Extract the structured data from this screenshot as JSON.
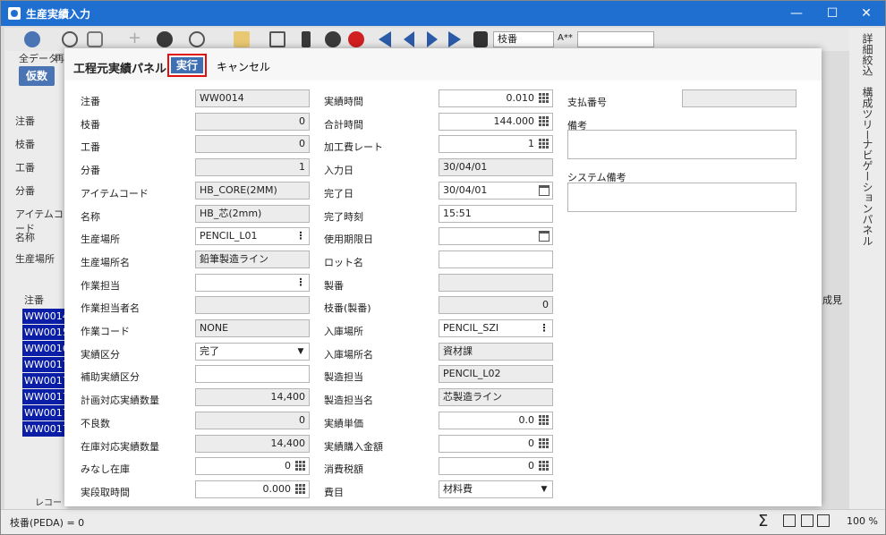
{
  "window": {
    "title": "生産実績入力",
    "minimize": "—",
    "maximize": "☐",
    "close": "✕"
  },
  "background": {
    "toolbar": {
      "sort_value": "枝番",
      "font_size_label": "A**"
    },
    "left_tabs": [
      "全データ",
      "再"
    ],
    "kari_button": "仮数",
    "left_labels": [
      "注番",
      "枝番",
      "工番",
      "分番",
      "アイテムコード",
      "名称",
      "生産場所"
    ],
    "grid_header": "注番",
    "grid_rows": [
      "WW0014",
      "WW0015",
      "WW0016",
      "WW0017",
      "WW0017",
      "WW0017",
      "WW0017",
      "WW0017"
    ],
    "pager_label": "レコー",
    "right_tabs": [
      "詳細絞込",
      "構成ツリー",
      "ナビゲーションパネル"
    ],
    "right_header_partial": "成見",
    "status_left": "枝番(PEDA) = 0",
    "status_zoom": "100  %"
  },
  "panel": {
    "title": "工程元実績パネル",
    "exec_label": "実行",
    "cancel_label": "キャンセル",
    "col1": [
      {
        "label": "注番",
        "value": "WW0014",
        "ro": true,
        "num": false,
        "icon": ""
      },
      {
        "label": "枝番",
        "value": "0",
        "ro": true,
        "num": true,
        "icon": ""
      },
      {
        "label": "工番",
        "value": "0",
        "ro": true,
        "num": true,
        "icon": ""
      },
      {
        "label": "分番",
        "value": "1",
        "ro": true,
        "num": true,
        "icon": ""
      },
      {
        "label": "アイテムコード",
        "value": "HB_CORE(2MM)",
        "ro": true,
        "num": false,
        "icon": ""
      },
      {
        "label": "名称",
        "value": "HB_芯(2mm)",
        "ro": true,
        "num": false,
        "icon": ""
      },
      {
        "label": "生産場所",
        "value": "PENCIL_L01",
        "ro": false,
        "num": false,
        "icon": "dots"
      },
      {
        "label": "生産場所名",
        "value": "鉛筆製造ライン",
        "ro": true,
        "num": false,
        "icon": ""
      },
      {
        "label": "作業担当",
        "value": "",
        "ro": false,
        "num": false,
        "icon": "dots"
      },
      {
        "label": "作業担当者名",
        "value": "",
        "ro": true,
        "num": false,
        "icon": ""
      },
      {
        "label": "作業コード",
        "value": "NONE",
        "ro": true,
        "num": false,
        "icon": ""
      },
      {
        "label": "実績区分",
        "value": "完了",
        "ro": false,
        "num": false,
        "icon": "dd"
      },
      {
        "label": "補助実績区分",
        "value": "",
        "ro": false,
        "num": false,
        "icon": ""
      },
      {
        "label": "計画対応実績数量",
        "value": "14,400",
        "ro": true,
        "num": true,
        "icon": ""
      },
      {
        "label": "不良数",
        "value": "0",
        "ro": true,
        "num": true,
        "icon": ""
      },
      {
        "label": "在庫対応実績数量",
        "value": "14,400",
        "ro": true,
        "num": true,
        "icon": ""
      },
      {
        "label": "みなし在庫",
        "value": "0",
        "ro": false,
        "num": true,
        "icon": "grid"
      },
      {
        "label": "実段取時間",
        "value": "0.000",
        "ro": false,
        "num": true,
        "icon": "grid"
      }
    ],
    "col2": [
      {
        "label": "実績時間",
        "value": "0.010",
        "ro": false,
        "num": true,
        "icon": "grid"
      },
      {
        "label": "合計時間",
        "value": "144.000",
        "ro": false,
        "num": true,
        "icon": "grid"
      },
      {
        "label": "加工費レート",
        "value": "1",
        "ro": false,
        "num": true,
        "icon": "grid"
      },
      {
        "label": "入力日",
        "value": "30/04/01",
        "ro": true,
        "num": false,
        "icon": ""
      },
      {
        "label": "完了日",
        "value": "30/04/01",
        "ro": false,
        "num": false,
        "icon": "cal"
      },
      {
        "label": "完了時刻",
        "value": "15:51",
        "ro": false,
        "num": false,
        "icon": ""
      },
      {
        "label": "使用期限日",
        "value": "",
        "ro": false,
        "num": false,
        "icon": "cal"
      },
      {
        "label": "ロット名",
        "value": "",
        "ro": false,
        "num": false,
        "icon": ""
      },
      {
        "label": "製番",
        "value": "",
        "ro": true,
        "num": false,
        "icon": ""
      },
      {
        "label": "枝番(製番)",
        "value": "0",
        "ro": true,
        "num": true,
        "icon": ""
      },
      {
        "label": "入庫場所",
        "value": "PENCIL_SZI",
        "ro": false,
        "num": false,
        "icon": "dots"
      },
      {
        "label": "入庫場所名",
        "value": "資材課",
        "ro": true,
        "num": false,
        "icon": ""
      },
      {
        "label": "製造担当",
        "value": "PENCIL_L02",
        "ro": true,
        "num": false,
        "icon": ""
      },
      {
        "label": "製造担当名",
        "value": "芯製造ライン",
        "ro": true,
        "num": false,
        "icon": ""
      },
      {
        "label": "実績単価",
        "value": "0.0",
        "ro": false,
        "num": true,
        "icon": "grid"
      },
      {
        "label": "実績購入金額",
        "value": "0",
        "ro": false,
        "num": true,
        "icon": "grid"
      },
      {
        "label": "消費税額",
        "value": "0",
        "ro": false,
        "num": true,
        "icon": "grid"
      },
      {
        "label": "費目",
        "value": "材料費",
        "ro": false,
        "num": false,
        "icon": "dd"
      }
    ],
    "col3": {
      "payment_label": "支払番号",
      "payment_value": "",
      "remarks_label": "備考",
      "system_remarks_label": "システム備考"
    }
  }
}
